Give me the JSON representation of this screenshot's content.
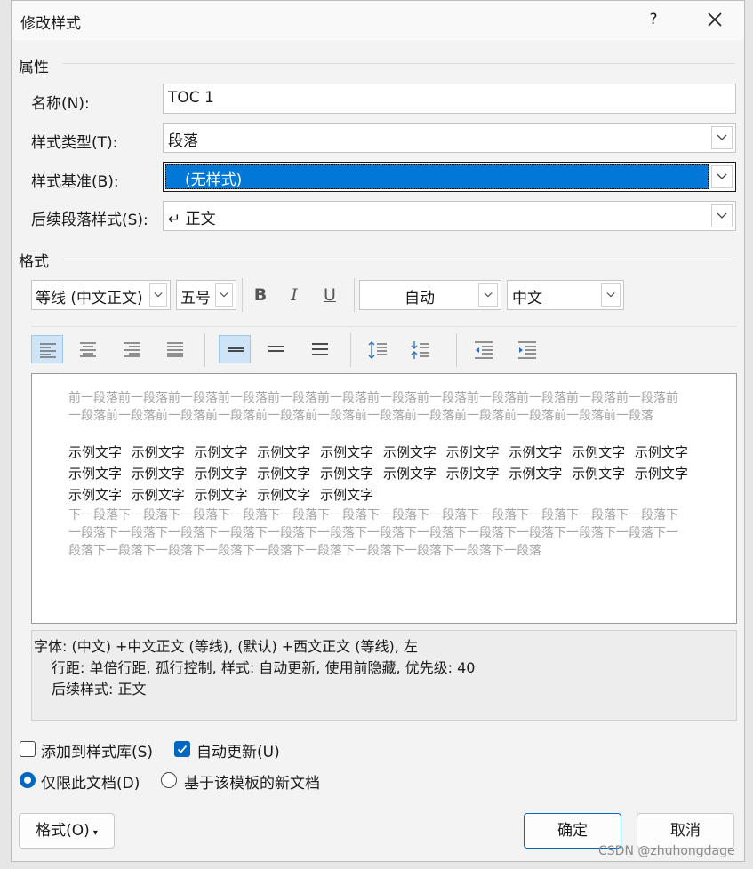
{
  "window": {
    "title": "修改样式",
    "help_label": "?"
  },
  "properties": {
    "heading": "属性",
    "name_label": "名称(N):",
    "name_value": "TOC 1",
    "style_type_label": "样式类型(T):",
    "style_type_value": "段落",
    "based_on_label": "样式基准(B):",
    "based_on_value": "(无样式)",
    "next_style_label": "后续段落样式(S):",
    "next_style_value": "↵ 正文"
  },
  "format": {
    "heading": "格式",
    "font": "等线 (中文正文)",
    "size": "五号",
    "bold": "B",
    "italic": "I",
    "underline": "U",
    "color": "自动",
    "script": "中文"
  },
  "preview": {
    "previous_paragraph": "前一段落前一段落前一段落前一段落前一段落前一段落前一段落前一段落前一段落前一段落前一段落前一段落前一段落前一段落前一段落前一段落前一段落前一段落前一段落前一段落前一段落前一段落前一段落前一段落",
    "sample_text": "示例文字 示例文字 示例文字 示例文字 示例文字 示例文字 示例文字 示例文字 示例文字 示例文字 示例文字 示例文字 示例文字 示例文字 示例文字 示例文字 示例文字 示例文字 示例文字 示例文字 示例文字 示例文字 示例文字 示例文字 示例文字",
    "next_paragraph": "下一段落下一段落下一段落下一段落下一段落下一段落下一段落下一段落下一段落下一段落下一段落下一段落下一段落下一段落下一段落下一段落下一段落下一段落下一段落下一段落下一段落下一段落下一段落下一段落下一段落下一段落下一段落下一段落下一段落下一段落下一段落下一段落下一段落下一段落"
  },
  "description": {
    "line1": "字体: (中文) +中文正文 (等线), (默认) +西文正文 (等线), 左",
    "line2": "行距: 单倍行距, 孤行控制, 样式: 自动更新, 使用前隐藏, 优先级: 40",
    "line3": "后续样式: 正文"
  },
  "options": {
    "add_to_gallery": "添加到样式库(S)",
    "add_to_gallery_checked": false,
    "auto_update": "自动更新(U)",
    "auto_update_checked": true,
    "only_this_doc": "仅限此文档(D)",
    "new_docs_template": "基于该模板的新文档",
    "selected_scope": "仅限此文档(D)"
  },
  "buttons": {
    "format": "格式(O)",
    "ok": "确定",
    "cancel": "取消"
  },
  "watermark": "CSDN @zhuhongdage",
  "colors": {
    "accent": "#0078d7",
    "selected_bg": "#cfe4f7"
  }
}
